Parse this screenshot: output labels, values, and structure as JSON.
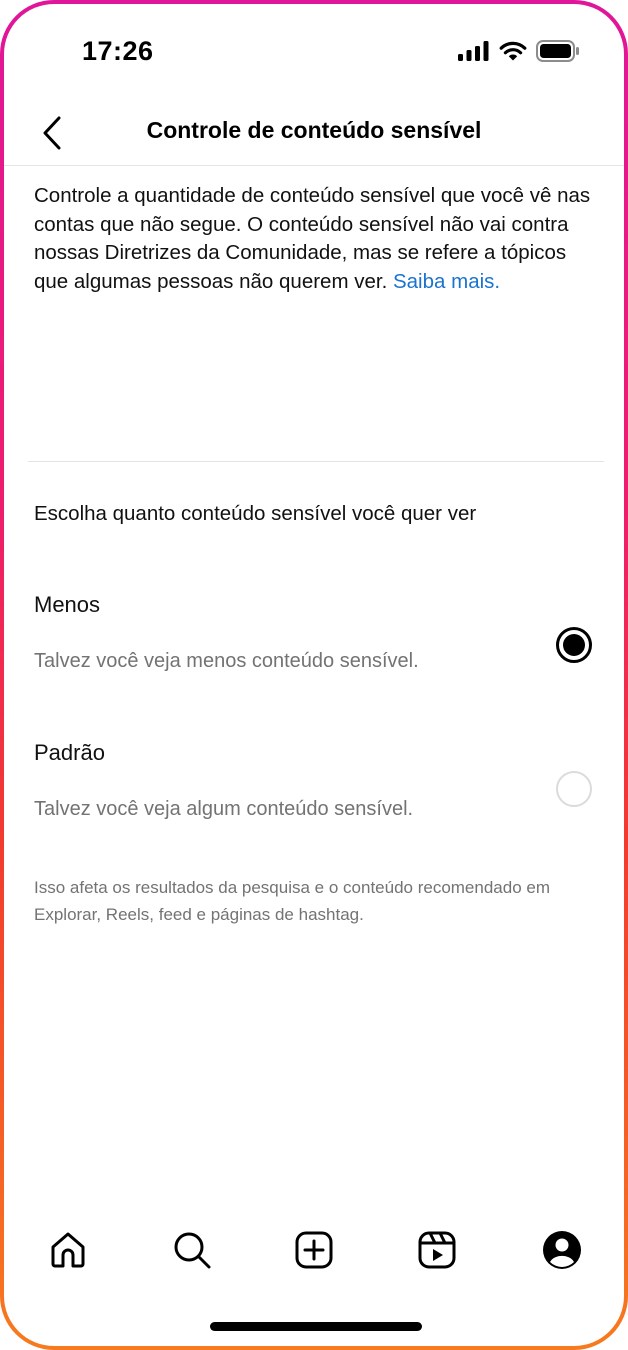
{
  "status_bar": {
    "time": "17:26",
    "icons": [
      "signal-icon",
      "wifi-icon",
      "battery-icon"
    ]
  },
  "header": {
    "title": "Controle de conteúdo sensível",
    "back_icon": "chevron-left-icon"
  },
  "intro": {
    "text": "Controle a quantidade de conteúdo sensível que você vê nas contas que não segue. O conteúdo sensível não vai contra nossas Diretrizes da Comunidade, mas se refere a tópicos que algumas pessoas não querem ver.",
    "link_label": "Saiba mais."
  },
  "section": {
    "heading": "Escolha quanto conteúdo sensível você quer ver"
  },
  "options": [
    {
      "title": "Menos",
      "description": "Talvez você veja menos conteúdo sensível.",
      "selected": true
    },
    {
      "title": "Padrão",
      "description": "Talvez você veja algum conteúdo sensível.",
      "selected": false
    }
  ],
  "footnote": "Isso afeta os resultados da pesquisa e o conteúdo recomendado em Explorar, Reels, feed e páginas de hashtag.",
  "bottom_nav": {
    "items": [
      "home-icon",
      "search-icon",
      "create-post-icon",
      "reels-icon",
      "profile-icon"
    ]
  },
  "colors": {
    "link": "#1a73d0",
    "secondary_text": "#737373",
    "frame_gradient_top": "#e0169a",
    "frame_gradient_bottom": "#f77a1e"
  }
}
